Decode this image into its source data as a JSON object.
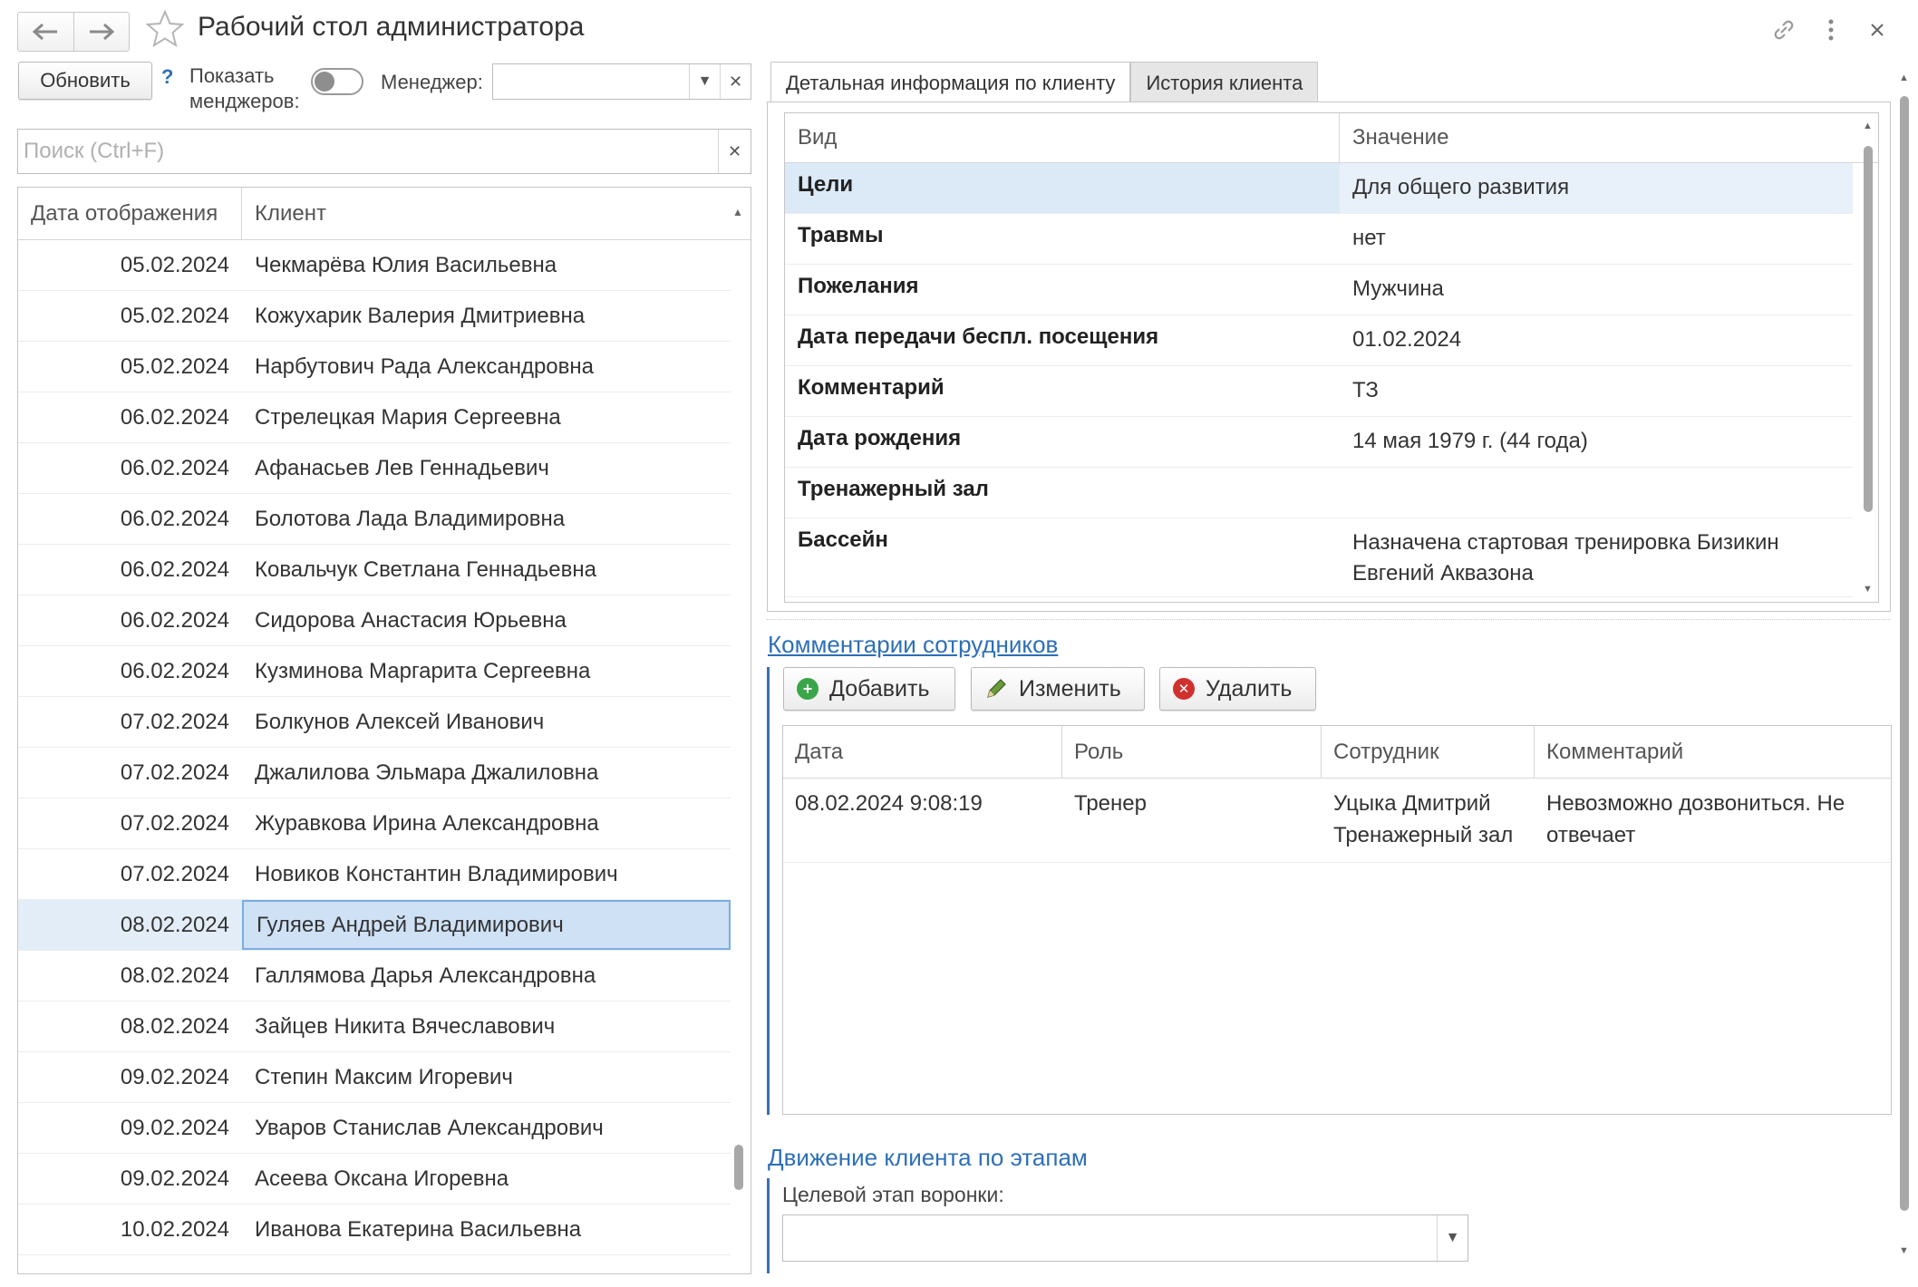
{
  "window": {
    "title": "Рабочий стол администратора",
    "back_icon": "arrow-left-icon",
    "forward_icon": "arrow-right-icon",
    "favorite_icon": "star-icon",
    "link_icon": "link-icon",
    "menu_icon": "more-vertical-icon",
    "close_icon": "close-icon"
  },
  "toolbar": {
    "refresh_label": "Обновить",
    "help_label": "?",
    "show_managers_label": "Показать менджеров:",
    "show_managers_on": false,
    "manager_label": "Менеджер:",
    "manager_value": ""
  },
  "search": {
    "placeholder": "Поиск (Ctrl+F)",
    "value": ""
  },
  "clients": {
    "columns": [
      "Дата отображения",
      "Клиент"
    ],
    "selected_index": 13,
    "rows": [
      {
        "date": "05.02.2024",
        "name": "Чекмарёва Юлия Васильевна"
      },
      {
        "date": "05.02.2024",
        "name": "Кожухарик Валерия Дмитриевна"
      },
      {
        "date": "05.02.2024",
        "name": "Нарбутович Рада Александровна"
      },
      {
        "date": "06.02.2024",
        "name": "Стрелецкая Мария Сергеевна"
      },
      {
        "date": "06.02.2024",
        "name": "Афанасьев Лев Геннадьевич"
      },
      {
        "date": "06.02.2024",
        "name": "Болотова Лада Владимировна"
      },
      {
        "date": "06.02.2024",
        "name": "Ковальчук Светлана Геннадьевна"
      },
      {
        "date": "06.02.2024",
        "name": "Сидорова Анастасия Юрьевна"
      },
      {
        "date": "06.02.2024",
        "name": "Кузминова Маргарита Сергеевна"
      },
      {
        "date": "07.02.2024",
        "name": "Болкунов Алексей Иванович"
      },
      {
        "date": "07.02.2024",
        "name": "Джалилова Эльмара Джалиловна"
      },
      {
        "date": "07.02.2024",
        "name": "Журавкова Ирина Александровна"
      },
      {
        "date": "07.02.2024",
        "name": "Новиков Константин Владимирович"
      },
      {
        "date": "08.02.2024",
        "name": "Гуляев Андрей Владимирович"
      },
      {
        "date": "08.02.2024",
        "name": "Галлямова Дарья Александровна"
      },
      {
        "date": "08.02.2024",
        "name": "Зайцев Никита Вячеславович"
      },
      {
        "date": "09.02.2024",
        "name": "Степин Максим Игоревич"
      },
      {
        "date": "09.02.2024",
        "name": "Уваров Станислав Александрович"
      },
      {
        "date": "09.02.2024",
        "name": "Асеева Оксана Игоревна"
      },
      {
        "date": "10.02.2024",
        "name": "Иванова Екатерина Васильевна"
      }
    ]
  },
  "tabs": [
    {
      "label": "Детальная информация по клиенту",
      "active": true
    },
    {
      "label": "История клиента",
      "active": false
    }
  ],
  "details": {
    "columns": [
      "Вид",
      "Значение"
    ],
    "rows": [
      {
        "key": "Цели",
        "value": "Для общего развития",
        "selected": true
      },
      {
        "key": "Травмы",
        "value": "нет"
      },
      {
        "key": "Пожелания",
        "value": "Мужчина"
      },
      {
        "key": "Дата передачи беспл. посещения",
        "value": "01.02.2024"
      },
      {
        "key": "Комментарий",
        "value": "ТЗ"
      },
      {
        "key": "Дата рождения",
        "value": "14 мая 1979 г. (44 года)"
      },
      {
        "key": "Тренажерный зал",
        "value": ""
      },
      {
        "key": "Бассейн",
        "value": "Назначена стартовая тренировка Бизикин Евгений Аквазона"
      }
    ]
  },
  "comments": {
    "title": "Комментарии сотрудников",
    "add_label": "Добавить",
    "edit_label": "Изменить",
    "delete_label": "Удалить",
    "columns": [
      "Дата",
      "Роль",
      "Сотрудник",
      "Комментарий"
    ],
    "rows": [
      {
        "date": "08.02.2024 9:08:19",
        "role": "Тренер",
        "employee": "Уцыка Дмитрий Тренажерный зал",
        "comment": "Невозможно дозвониться. Не отвечает"
      }
    ]
  },
  "stages": {
    "title": "Движение клиента по этапам",
    "target_label": "Целевой этап воронки:",
    "target_value": ""
  },
  "colors": {
    "accent": "#2d6fb7",
    "selection": "#cfe1f5",
    "add_icon": "#3aa64a",
    "delete_icon": "#d0312d"
  }
}
